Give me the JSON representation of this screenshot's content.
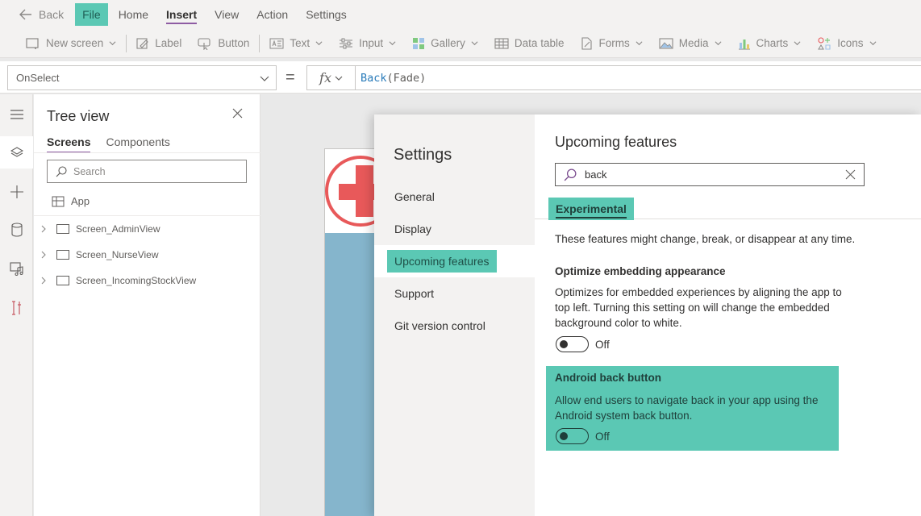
{
  "menubar": {
    "back_label": "Back",
    "items": [
      "File",
      "Home",
      "Insert",
      "View",
      "Action",
      "Settings"
    ]
  },
  "ribbon": {
    "new_screen": "New screen",
    "label": "Label",
    "button": "Button",
    "text": "Text",
    "input": "Input",
    "gallery": "Gallery",
    "data_table": "Data table",
    "forms": "Forms",
    "media": "Media",
    "charts": "Charts",
    "icons": "Icons"
  },
  "formula_bar": {
    "property": "OnSelect",
    "equals": "=",
    "fx": "fx",
    "formula_fn": "Back",
    "formula_args": "(Fade)"
  },
  "tree_view": {
    "title": "Tree view",
    "tabs": [
      "Screens",
      "Components"
    ],
    "search_placeholder": "Search",
    "app_label": "App",
    "screens": [
      "Screen_AdminView",
      "Screen_NurseView",
      "Screen_IncomingStockView"
    ]
  },
  "settings": {
    "title": "Settings",
    "nav": [
      "General",
      "Display",
      "Upcoming features",
      "Support",
      "Git version control"
    ],
    "selected_nav": "Upcoming features",
    "main_title": "Upcoming features",
    "search_value": "back",
    "tab": "Experimental",
    "note": "These features might change, break, or disappear at any time.",
    "features": [
      {
        "title": "Optimize embedding appearance",
        "description": "Optimizes for embedded experiences by aligning the app to top left. Turning this setting on will change the embedded background color to white.",
        "state": "Off"
      },
      {
        "title": "Android back button",
        "description": "Allow end users to navigate back in your app using the Android system back button.",
        "state": "Off"
      }
    ]
  },
  "colors": {
    "highlight": "#5bc8b4",
    "accent_purple": "#8e5ca3",
    "logo_red": "#e8595a",
    "canvas_blue": "#85b5cc"
  }
}
